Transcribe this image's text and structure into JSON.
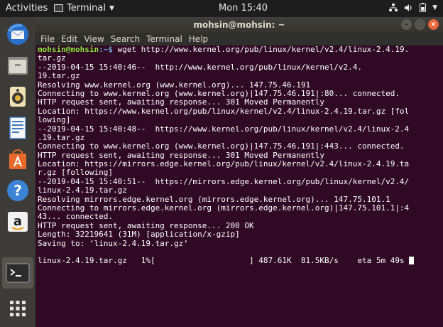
{
  "topbar": {
    "activities": "Activities",
    "app_name": "Terminal",
    "clock": "Mon 15:40"
  },
  "window": {
    "title": "mohsin@mohsin: ~"
  },
  "menu": {
    "file": "File",
    "edit": "Edit",
    "view": "View",
    "search": "Search",
    "terminal": "Terminal",
    "help": "Help"
  },
  "dock": {
    "items": [
      "Thunderbird",
      "Files",
      "Rhythmbox",
      "LibreOffice Writer",
      "Ubuntu Software",
      "Help",
      "Amazon",
      "Terminal",
      "Show Applications"
    ]
  },
  "terminal": {
    "prompt_user": "mohsin@mohsin",
    "prompt_path": ":~$",
    "command": " wget http://www.kernel.org/pub/linux/kernel/v2.4/linux-2.4.19.",
    "lines": [
      "tar.gz",
      "--2019-04-15 15:40:46--  http://www.kernel.org/pub/linux/kernel/v2.4.",
      "19.tar.gz",
      "Resolving www.kernel.org (www.kernel.org)... 147.75.46.191",
      "Connecting to www.kernel.org (www.kernel.org)|147.75.46.191|:80... connected.",
      "HTTP request sent, awaiting response... 301 Moved Permanently",
      "Location: https://www.kernel.org/pub/linux/kernel/v2.4/linux-2.4.19.tar.gz [fol",
      "lowing]",
      "--2019-04-15 15:40:48--  https://www.kernel.org/pub/linux/kernel/v2.4/linux-2.4",
      ".19.tar.gz",
      "Connecting to www.kernel.org (www.kernel.org)|147.75.46.191|:443... connected.",
      "HTTP request sent, awaiting response... 301 Moved Permanently",
      "Location: https://mirrors.edge.kernel.org/pub/linux/kernel/v2.4/linux-2.4.19.ta",
      "r.gz [following]",
      "--2019-04-15 15:40:51--  https://mirrors.edge.kernel.org/pub/linux/kernel/v2.4/",
      "linux-2.4.19.tar.gz",
      "Resolving mirrors.edge.kernel.org (mirrors.edge.kernel.org)... 147.75.101.1",
      "Connecting to mirrors.edge.kernel.org (mirrors.edge.kernel.org)|147.75.101.1|:4",
      "43... connected.",
      "HTTP request sent, awaiting response... 200 OK",
      "Length: 32219641 (31M) [application/x-gzip]",
      "Saving to: ‘linux-2.4.19.tar.gz’",
      ""
    ],
    "progress_line": "linux-2.4.19.tar.gz   1%[                    ] 487.61K  81.5KB/s    eta 5m 49s "
  },
  "colors": {
    "terminal_bg": "#300a24",
    "prompt_user": "#8ae234",
    "prompt_path": "#729fcf",
    "dock_bg": "#3c3b37"
  }
}
